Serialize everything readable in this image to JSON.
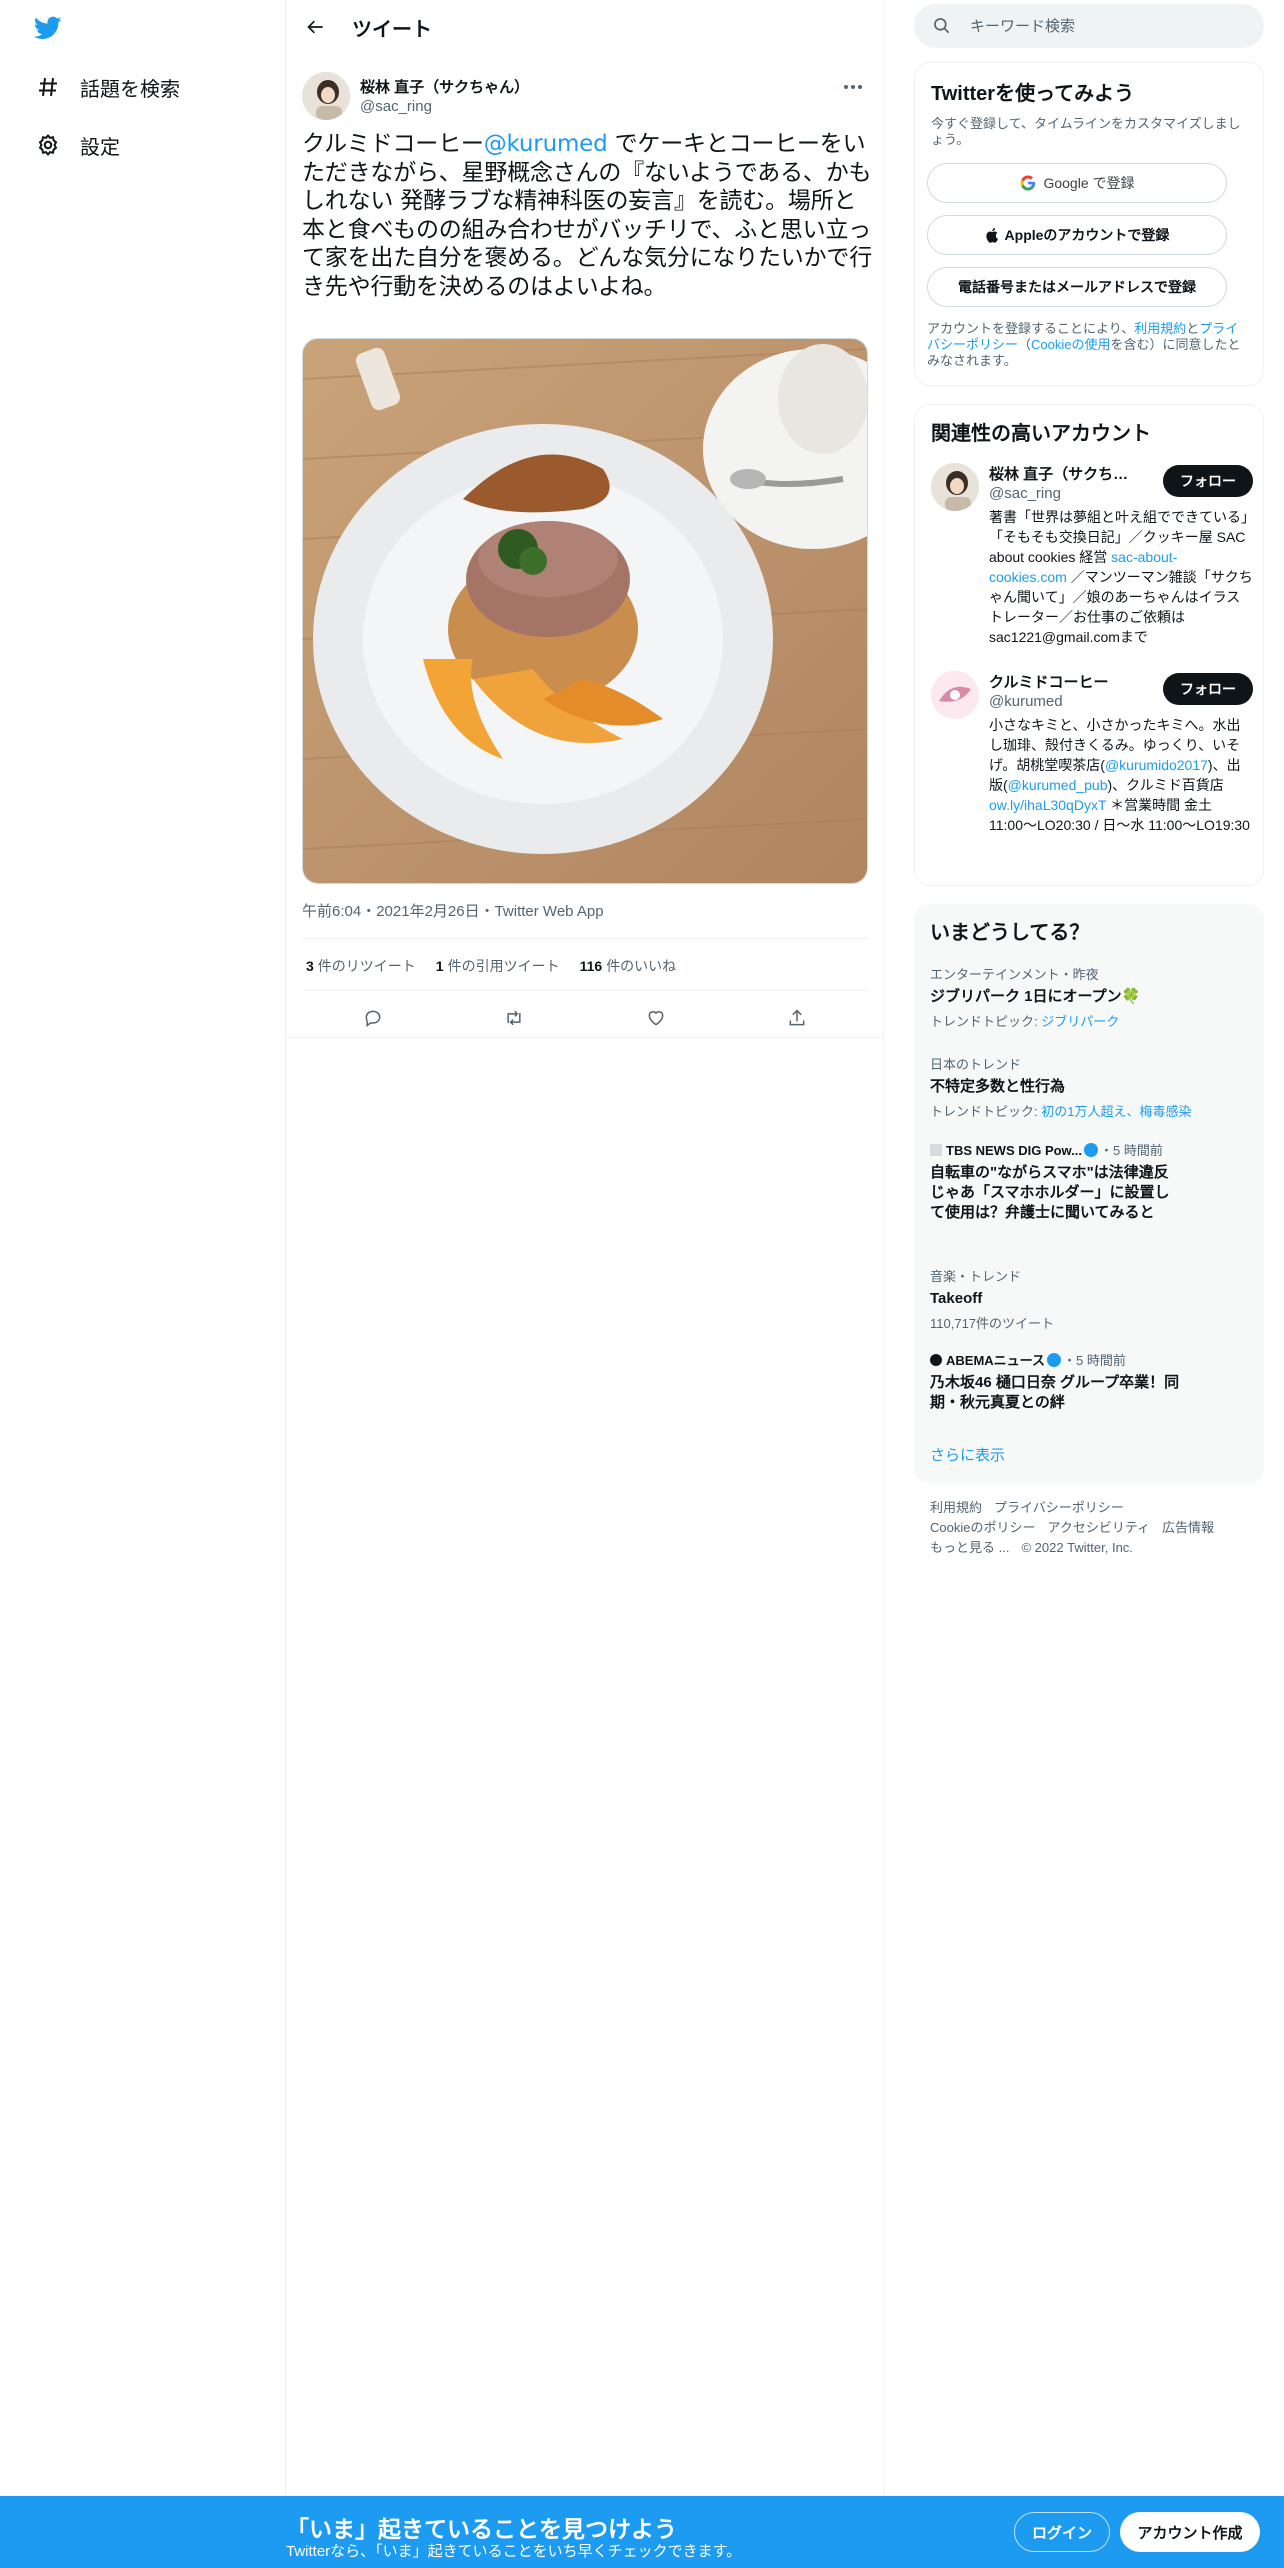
{
  "nav": {
    "logo_icon": "twitter-bird-icon",
    "items": [
      {
        "label": "話題を検索",
        "icon": "hashtag-icon"
      },
      {
        "label": "設定",
        "icon": "gear-icon"
      }
    ]
  },
  "header": {
    "title": "ツイート"
  },
  "tweet": {
    "author_name": "桜林 直子（サクちゃん）",
    "author_handle": "@sac_ring",
    "text_before": "クルミドコーヒー",
    "mention": "@kurumed",
    "text_after": " でケーキとコーヒーをいただきながら、星野概念さんの『ないようである、かもしれない 発酵ラブな精神科医の妄言』を読む。場所と本と食べものの組み合わせがバッチリで、ふと思い立って家を出た自分を褒める。どんな気分になりたいかで行き先や行動を決めるのはよいよね。",
    "meta": "午前6:04・2021年2月26日・Twitter Web App",
    "retweets_count": "3",
    "retweets_label": "件のリツイート",
    "quotes_count": "1",
    "quotes_label": "件の引用ツイート",
    "likes_count": "116",
    "likes_label": "件のいいね"
  },
  "right": {
    "search_placeholder": "キーワード検索",
    "signup": {
      "title": "Twitterを使ってみよう",
      "subtitle": "今すぐ登録して、タイムラインをカスタマイズしましょう。",
      "google": "Google で登録",
      "apple": "Appleのアカウントで登録",
      "phone": "電話番号またはメールアドレスで登録",
      "terms_prefix": "アカウントを登録することにより、",
      "terms_link1": "利用規約",
      "terms_mid": "と",
      "terms_link2": "プライバシーポリシー",
      "terms_mid2": "（",
      "terms_link3": "Cookieの使用",
      "terms_suffix": "を含む）に同意したとみなされます。"
    },
    "related": {
      "title": "関連性の高いアカウント",
      "accounts": [
        {
          "name": "桜林 直子（サクちゃん）",
          "handle": "@sac_ring",
          "follow": "フォロー",
          "bio_before": "著書「世界は夢組と叶え組でできている」「そもそも交換日記」／クッキー屋 SAC about cookies 経営 ",
          "bio_link": "sac-about-cookies.com",
          "bio_after": " ／マンツーマン雑談「サクちゃん聞いて」／娘のあーちゃんはイラストレーター／お仕事のご依頼は sac1221@gmail.comまで"
        },
        {
          "name": "クルミドコーヒー",
          "handle": "@kurumed",
          "follow": "フォロー",
          "bio_1": "小さなキミと、小さかったキミへ。水出し珈琲、殻付きくるみ。ゆっくり、いそげ。胡桃堂喫茶店(",
          "bio_link1": "@kurumido2017",
          "bio_2": ")、出版(",
          "bio_link2": "@kurumed_pub",
          "bio_3": ")、クルミド百貨店 ",
          "bio_link3": "ow.ly/ihaL30qDyxT",
          "bio_4": " ＊営業時間 金土 11:00〜LO20:30 / 日〜水 11:00〜LO19:30"
        }
      ]
    },
    "trends": {
      "title": "いまどうしてる？",
      "items": [
        {
          "context": "エンターテインメント・昨夜",
          "title": "ジブリパーク 1日にオープン🍀",
          "topic_prefix": "トレンドトピック: ",
          "topic": "ジブリパーク"
        },
        {
          "context": "日本のトレンド",
          "title": "不特定多数と性行為",
          "topic_prefix": "トレンドトピック: ",
          "topic": "初の1万人超え、梅毒感染"
        },
        {
          "context_src": "TBS NEWS DIG Pow...",
          "context_time": "・5 時間前",
          "title": "自転車の\"ながらスマホ\"は法律違反　じゃあ「スマホホルダー」に設置して使用は？弁護士に聞いてみると"
        },
        {
          "context": "音楽・トレンド",
          "title": "Takeoff",
          "topic_plain": "110,717件のツイート"
        },
        {
          "context_src": "ABEMAニュース",
          "context_time": "・5 時間前",
          "title": "乃木坂46 樋口日奈 グループ卒業！同期・秋元真夏との絆"
        }
      ],
      "more": "さらに表示"
    },
    "footer": {
      "links": [
        "利用規約",
        "プライバシーポリシー",
        "Cookieのポリシー",
        "アクセシビリティ",
        "広告情報",
        "もっと見る ...",
        "© 2022 Twitter, Inc."
      ]
    }
  },
  "bottom": {
    "title": "「いま」起きていることを見つけよう",
    "subtitle": "Twitterなら、「いま」起きていることをいち早くチェックできます。",
    "login": "ログイン",
    "signup": "アカウント作成"
  },
  "colors": {
    "accent": "#1d9bf0",
    "text": "#0f1419",
    "muted": "#536471",
    "border": "#eff3f4"
  }
}
